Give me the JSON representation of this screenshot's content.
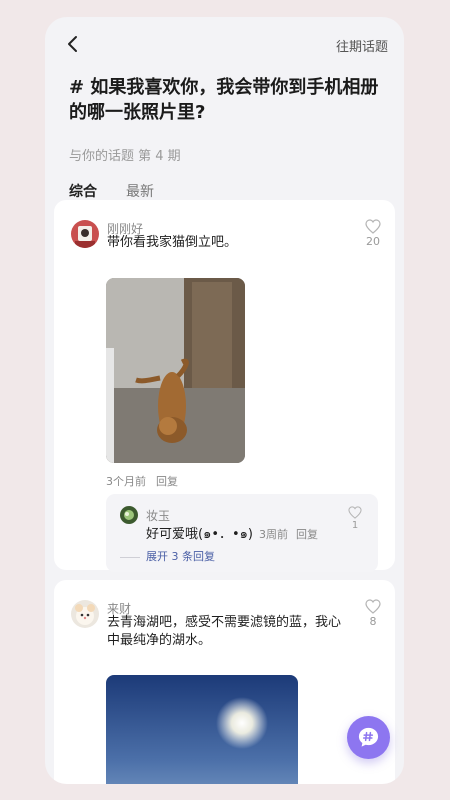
{
  "header": {
    "back_icon": "chevron-left-icon",
    "history_label": "往期话题"
  },
  "topic": {
    "title": "# 如果我喜欢你，我会带你到手机相册的哪一张照片里?",
    "subtitle": "与你的话题 第 4 期"
  },
  "tabs": [
    {
      "label": "综合",
      "active": true
    },
    {
      "label": "最新",
      "active": false
    }
  ],
  "posts": [
    {
      "username": "刚刚好",
      "text": "带你看我家猫倒立吧。",
      "likes": "20",
      "time": "3个月前",
      "reply_label": "回复",
      "image": "cat-handstand-photo",
      "comment": {
        "username": "妆玉",
        "text": "好可爱哦(๑•．•๑)",
        "time": "3周前",
        "reply_label": "回复",
        "likes": "1",
        "expand_label": "展开 3 条回复"
      }
    },
    {
      "username": "来财",
      "text": "去青海湖吧，感受不需要滤镜的蓝，我心中最纯净的湖水。",
      "likes": "8",
      "image": "qinghai-lake-photo"
    }
  ],
  "fab": {
    "icon": "hashtag-chat-icon",
    "color": "#8d76f0"
  },
  "colors": {
    "accent": "#6f5fe6",
    "link": "#4a5fa6",
    "background": "#f1e8e9"
  }
}
